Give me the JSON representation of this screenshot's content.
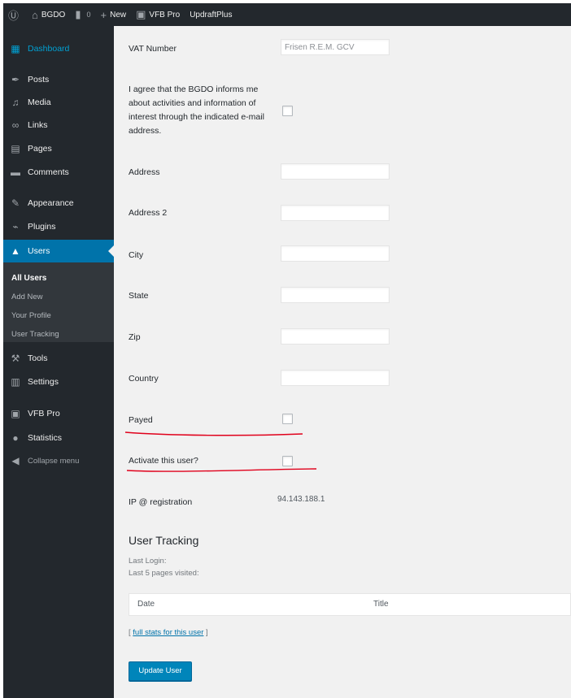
{
  "adminbar": {
    "site_name": "BGDO",
    "comments_count": "0",
    "new_label": "New",
    "vfb_label": "VFB Pro",
    "updraft_label": "UpdraftPlus"
  },
  "sidebar": {
    "items": [
      {
        "label": "Dashboard",
        "icon": "dashboard-icon",
        "glyph": "▦"
      },
      {
        "label": "Posts",
        "icon": "pin-icon",
        "glyph": "✒"
      },
      {
        "label": "Media",
        "icon": "media-icon",
        "glyph": "♫"
      },
      {
        "label": "Links",
        "icon": "link-icon",
        "glyph": "∞"
      },
      {
        "label": "Pages",
        "icon": "pages-icon",
        "glyph": "▤"
      },
      {
        "label": "Comments",
        "icon": "comments-icon",
        "glyph": "▬"
      },
      {
        "label": "Appearance",
        "icon": "appearance-icon",
        "glyph": "✎"
      },
      {
        "label": "Plugins",
        "icon": "plugins-icon",
        "glyph": "⌁"
      },
      {
        "label": "Users",
        "icon": "users-icon",
        "glyph": "▲"
      },
      {
        "label": "Tools",
        "icon": "tools-icon",
        "glyph": "⚒"
      },
      {
        "label": "Settings",
        "icon": "settings-icon",
        "glyph": "▥"
      },
      {
        "label": "VFB Pro",
        "icon": "vfb-icon",
        "glyph": "▣"
      },
      {
        "label": "Statistics",
        "icon": "statistics-icon",
        "glyph": "●"
      },
      {
        "label": "Collapse menu",
        "icon": "collapse-icon",
        "glyph": "◀"
      }
    ],
    "submenu": [
      "All Users",
      "Add New",
      "Your Profile",
      "User Tracking"
    ]
  },
  "form": {
    "vat_label": "VAT Number",
    "vat_value": "Frisen R.E.M. GCV",
    "consent_text": "I agree that the BGDO informs me about activities and information of interest through the indicated e-mail address.",
    "address_label": "Address",
    "address2_label": "Address 2",
    "city_label": "City",
    "state_label": "State",
    "zip_label": "Zip",
    "country_label": "Country",
    "payed_label": "Payed",
    "activate_label": "Activate this user?",
    "ip_label": "IP @ registration",
    "ip_value": "94.143.188.1"
  },
  "tracking": {
    "title": "User Tracking",
    "last_login": "Last Login:",
    "last_pages": "Last 5 pages visited:",
    "col_date": "Date",
    "col_title": "Title",
    "stats_open": "[ ",
    "stats_link": "full stats for this user",
    "stats_close": " ]"
  },
  "update_button": "Update User",
  "colors": {
    "sidebar_bg": "#23282d",
    "accent": "#0073aa",
    "button": "#0085ba",
    "annotation": "#e0001b"
  }
}
